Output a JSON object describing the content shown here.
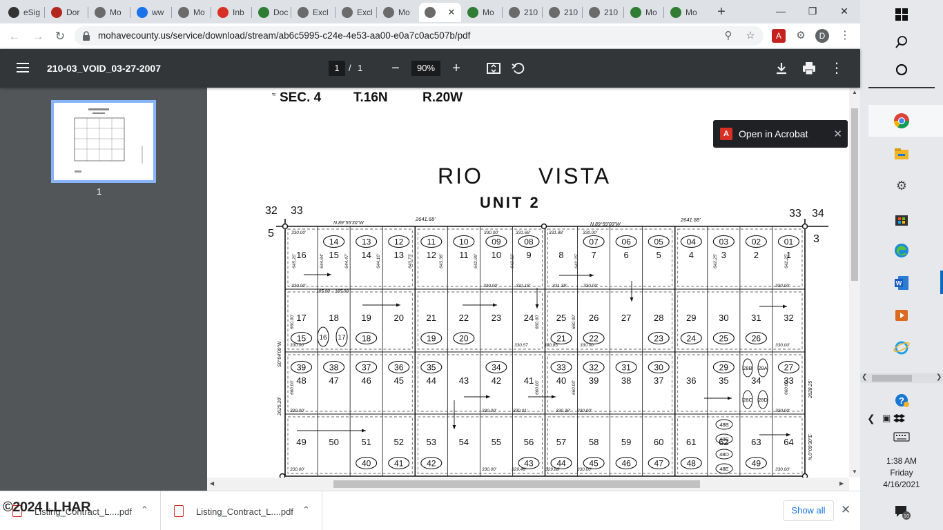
{
  "browser": {
    "tabs": [
      {
        "label": "eSig",
        "color": "#333333"
      },
      {
        "label": "Dor",
        "color": "#b3261e"
      },
      {
        "label": "Mo",
        "color": "#6b6b6b"
      },
      {
        "label": "ww",
        "color": "#1a73e8"
      },
      {
        "label": "Mo",
        "color": "#6b6b6b"
      },
      {
        "label": "Inb",
        "color": "#d93025"
      },
      {
        "label": "Doc",
        "color": "#2e7d32"
      },
      {
        "label": "Excl",
        "color": "#6b6b6b"
      },
      {
        "label": "Excl",
        "color": "#6b6b6b"
      },
      {
        "label": "Mo",
        "color": "#6b6b6b"
      },
      {
        "label": "",
        "color": "#6b6b6b"
      },
      {
        "label": "Mo",
        "color": "#2e7d32"
      },
      {
        "label": "210",
        "color": "#6b6b6b"
      },
      {
        "label": "210",
        "color": "#6b6b6b"
      },
      {
        "label": "210",
        "color": "#6b6b6b"
      },
      {
        "label": "Mo",
        "color": "#2e7d32"
      },
      {
        "label": "Mo",
        "color": "#2e7d32"
      }
    ],
    "active_tab": 10,
    "url": "mohavecounty.us/service/download/stream/ab6c5995-c24e-4e53-aa00-e0a7c0ac507b/pdf",
    "profile_initial": "D"
  },
  "pdf": {
    "title": "210-03_VOID_03-27-2007",
    "page_current": "1",
    "page_sep": "/",
    "page_total": "1",
    "zoom": "90%",
    "thumb_label": "1",
    "open_in_acrobat": "Open in Acrobat"
  },
  "map": {
    "header": [
      "SEC. 4",
      "T.16N",
      "R.20W"
    ],
    "title1": "RIO",
    "title2": "VISTA",
    "subtitle": "UNIT  2",
    "corners": {
      "tl_a": "32",
      "tl_b": "33",
      "tl_left": "5",
      "tr_a": "33",
      "tr_b": "34",
      "tr_right": "3"
    },
    "dims": {
      "top1": "N.89°55'30\"W",
      "top2": "2641.68'",
      "top3": "N.89°59'00\"W",
      "top4": "2641.88'",
      "left1": "S0°04'00\"W",
      "left2": "2625.20'",
      "right1": "2628.25'",
      "right2": "N.0°09'30\"E"
    },
    "row1": {
      "lots": [
        "16",
        "15",
        "14",
        "13",
        "12",
        "11",
        "10",
        "9",
        "8",
        "7",
        "6",
        "5",
        "4",
        "3",
        "2",
        "1"
      ],
      "circles": [
        "",
        "14",
        "13",
        "12",
        "11",
        "10",
        "09",
        "08",
        "",
        "07",
        "06",
        "05",
        "04",
        "03",
        "02",
        "01"
      ]
    },
    "row2": {
      "lots": [
        "17",
        "18",
        "19",
        "20",
        "21",
        "22",
        "23",
        "24",
        "25",
        "26",
        "27",
        "28",
        "29",
        "30",
        "31",
        "32"
      ],
      "circles": [
        "15",
        "",
        "18",
        "",
        "19",
        "20",
        "",
        "",
        "21",
        "22",
        "",
        "23",
        "24",
        "25",
        "26",
        ""
      ],
      "extra_circles": [
        "16",
        "17"
      ]
    },
    "row3": {
      "lots": [
        "48",
        "47",
        "46",
        "45",
        "44",
        "43",
        "42",
        "41",
        "40",
        "39",
        "38",
        "37",
        "36",
        "35",
        "34",
        "33"
      ],
      "circles": [
        "39",
        "38",
        "37",
        "36",
        "35",
        "",
        "34",
        "",
        "33",
        "32",
        "31",
        "30",
        "",
        "29",
        "",
        "27"
      ],
      "extra_circles": [
        "28B",
        "28A",
        "28C",
        "28D"
      ]
    },
    "row4": {
      "lots": [
        "49",
        "50",
        "51",
        "52",
        "53",
        "54",
        "55",
        "56",
        "57",
        "58",
        "59",
        "60",
        "61",
        "62",
        "63",
        "64"
      ],
      "circles": [
        "",
        "",
        "40",
        "41",
        "42",
        "",
        "",
        "43",
        "44",
        "45",
        "46",
        "47",
        "48",
        "",
        "49",
        ""
      ],
      "extra_circles": [
        "48B",
        "48C",
        "48D",
        "48E"
      ]
    },
    "small_dims": [
      "330.00'",
      "330.00'",
      "331.68'",
      "331.88'",
      "330.00'",
      "330.00'",
      "330.00'",
      "331.18'",
      "331.38'",
      "330.00'",
      "330.00'",
      "645.20'",
      "644.84'",
      "644.47'",
      "644.10'",
      "643.73'",
      "643.36'",
      "642.99'",
      "642.62'",
      "642.25'",
      "642.25'",
      "642.25'",
      "165.00",
      "165.00",
      "330.00'",
      "330.57",
      "330.85'",
      "330.00'",
      "330.00'",
      "660.00'",
      "660.00'",
      "660.00'",
      "330.00'",
      "330.00'",
      "330.01'",
      "330.38'",
      "330.00'",
      "330.00'",
      "660.00'",
      "660.00'",
      "660.00'",
      "660.00'",
      "330.00'",
      "330.00'",
      "329.46'",
      "329.88'",
      "330.00'",
      "330.00'"
    ]
  },
  "downloads": {
    "items": [
      "Listing_Contract_L....pdf",
      "Listing_Contract_L....pdf"
    ],
    "show_all": "Show all"
  },
  "watermark": "©2024 LLHAR",
  "taskbar": {
    "time": "1:38 AM",
    "day": "Friday",
    "date": "4/16/2021",
    "notif_count": "10"
  }
}
